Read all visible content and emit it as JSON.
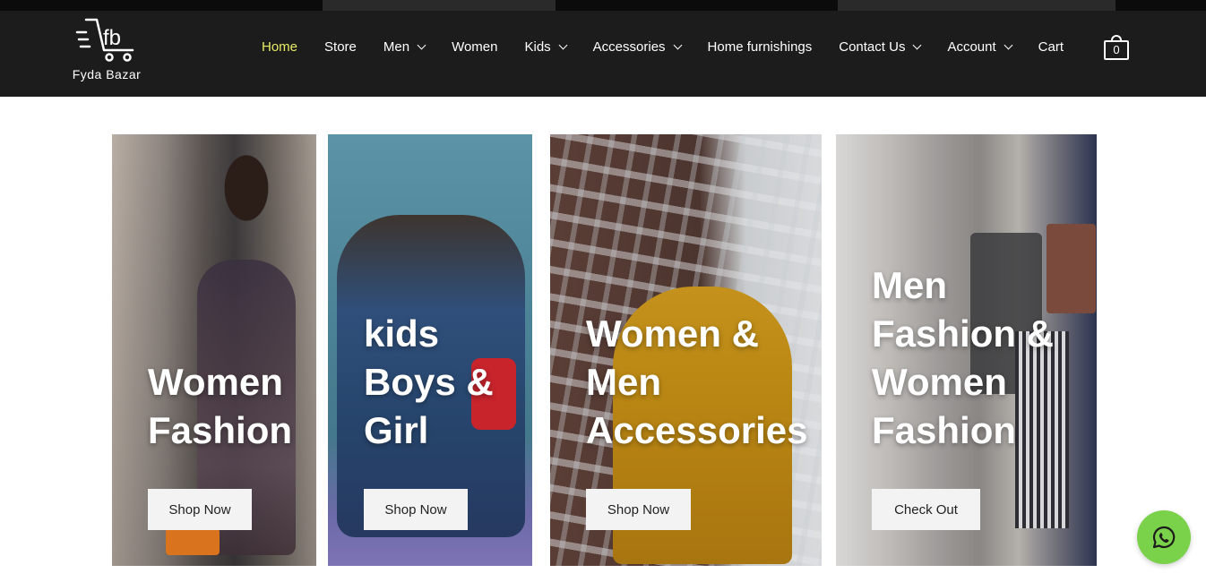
{
  "brand": {
    "logo_text": "fb",
    "name": "Fyda Bazar"
  },
  "nav": [
    {
      "label": "Home",
      "active": true,
      "dropdown": false
    },
    {
      "label": "Store",
      "active": false,
      "dropdown": false
    },
    {
      "label": "Men",
      "active": false,
      "dropdown": true
    },
    {
      "label": "Women",
      "active": false,
      "dropdown": false
    },
    {
      "label": "Kids",
      "active": false,
      "dropdown": true
    },
    {
      "label": "Accessories",
      "active": false,
      "dropdown": true
    },
    {
      "label": "Home furnishings",
      "active": false,
      "dropdown": false
    },
    {
      "label": "Contact Us",
      "active": false,
      "dropdown": true
    },
    {
      "label": "Account",
      "active": false,
      "dropdown": true
    },
    {
      "label": "Cart",
      "active": false,
      "dropdown": false
    }
  ],
  "cart": {
    "count": "0"
  },
  "cards": [
    {
      "title_lines": [
        "Women",
        "Fashion"
      ],
      "button": "Shop Now"
    },
    {
      "title_lines": [
        "kids",
        "Boys &",
        "Girl"
      ],
      "button": "Shop Now"
    },
    {
      "title_lines": [
        "Women &",
        "Men",
        "Accessories"
      ],
      "button": "Shop Now"
    },
    {
      "title_lines": [
        "Men",
        "Fashion &",
        "Women",
        "Fashion"
      ],
      "button": "Check Out"
    }
  ],
  "colors": {
    "header_bg": "#1c1c1c",
    "active_nav": "#e8ec63",
    "whatsapp": "#7ad14a"
  },
  "icons": {
    "whatsapp": "whatsapp-icon",
    "cart": "shopping-bag-icon",
    "logo": "cart-logo-icon"
  }
}
